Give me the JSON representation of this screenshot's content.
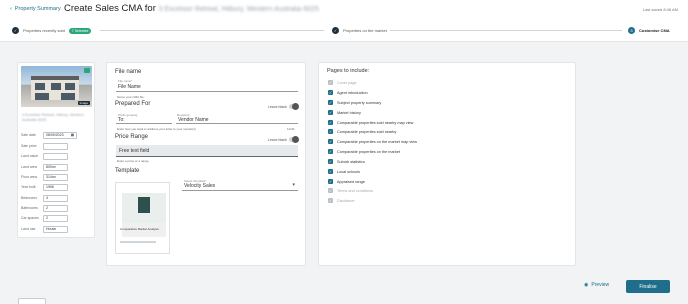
{
  "header": {
    "back_label": "Property Summary",
    "title": "Create Sales CMA for",
    "title_address": "3 Excelsior Retreat, Hilbury, Western Australia 6025",
    "last_saved": "Last saved 8:46 AM"
  },
  "steps": [
    {
      "label": "Properties recently sold",
      "badge": "7 Selected"
    },
    {
      "label": "Properties on the market"
    },
    {
      "number": "3",
      "label": "Customise CMA"
    }
  ],
  "property": {
    "address": "3 Excelsior Retreat, Hilbury, Western Australia 6025",
    "image_tag": "Image",
    "fields": [
      {
        "label": "Sale date",
        "value": "08/09/2023"
      },
      {
        "label": "Sale price",
        "value": ""
      },
      {
        "label": "Land value",
        "value": ""
      },
      {
        "label": "Land area",
        "value": "800m²"
      },
      {
        "label": "Floor area",
        "value": "314m²"
      },
      {
        "label": "Year built",
        "value": "1996"
      },
      {
        "label": "Bedrooms",
        "value": "4"
      },
      {
        "label": "Bathrooms",
        "value": "2"
      },
      {
        "label": "Car spaces",
        "value": "2"
      },
      {
        "label": "Land use",
        "value": "House"
      }
    ]
  },
  "form": {
    "file_name_title": "File name",
    "file_name_small": "File name*",
    "file_name_value": "File Name",
    "file_name_helper": "Name your CMA file",
    "prepared_for_title": "Prepared For",
    "leave_blank": "Leave blank",
    "prefix_small": "Prefix greeting",
    "prefix_value": "To:",
    "recipient_small": "Recipient",
    "recipient_value": "Vendor Name",
    "prepared_helper": "Enter how you want to address your letter to your vendor(s)",
    "prepared_count": "11/40",
    "price_range_title": "Price Range",
    "price_range_value": "Free text field",
    "price_helper": "Enter a price or a range",
    "template_title": "Template",
    "template_small": "Select Template*",
    "template_value": "Velocity Sales",
    "thumb_title": "Comparative Market Analysis"
  },
  "pages": {
    "title": "Pages to include:",
    "items": [
      {
        "label": "Cover page",
        "checked": true,
        "disabled": true
      },
      {
        "label": "Agent introduction",
        "checked": true,
        "disabled": false
      },
      {
        "label": "Subject property summary",
        "checked": true,
        "disabled": false
      },
      {
        "label": "Market history",
        "checked": true,
        "disabled": false
      },
      {
        "label": "Comparable properties sold nearby map view",
        "checked": true,
        "disabled": false
      },
      {
        "label": "Comparable properties sold nearby",
        "checked": true,
        "disabled": false
      },
      {
        "label": "Comparable properties on the market map view",
        "checked": true,
        "disabled": false
      },
      {
        "label": "Comparable properties on the market",
        "checked": true,
        "disabled": false
      },
      {
        "label": "Suburb statistics",
        "checked": true,
        "disabled": false
      },
      {
        "label": "Local schools",
        "checked": true,
        "disabled": false
      },
      {
        "label": "Appraised range",
        "checked": true,
        "disabled": false
      },
      {
        "label": "Terms and conditions",
        "checked": true,
        "disabled": true
      },
      {
        "label": "Disclaimer",
        "checked": true,
        "disabled": true
      }
    ]
  },
  "footer": {
    "preview": "Preview",
    "finalise": "Finalise"
  },
  "colors": {
    "accent": "#1f6e8c",
    "success": "#2aa67a"
  }
}
